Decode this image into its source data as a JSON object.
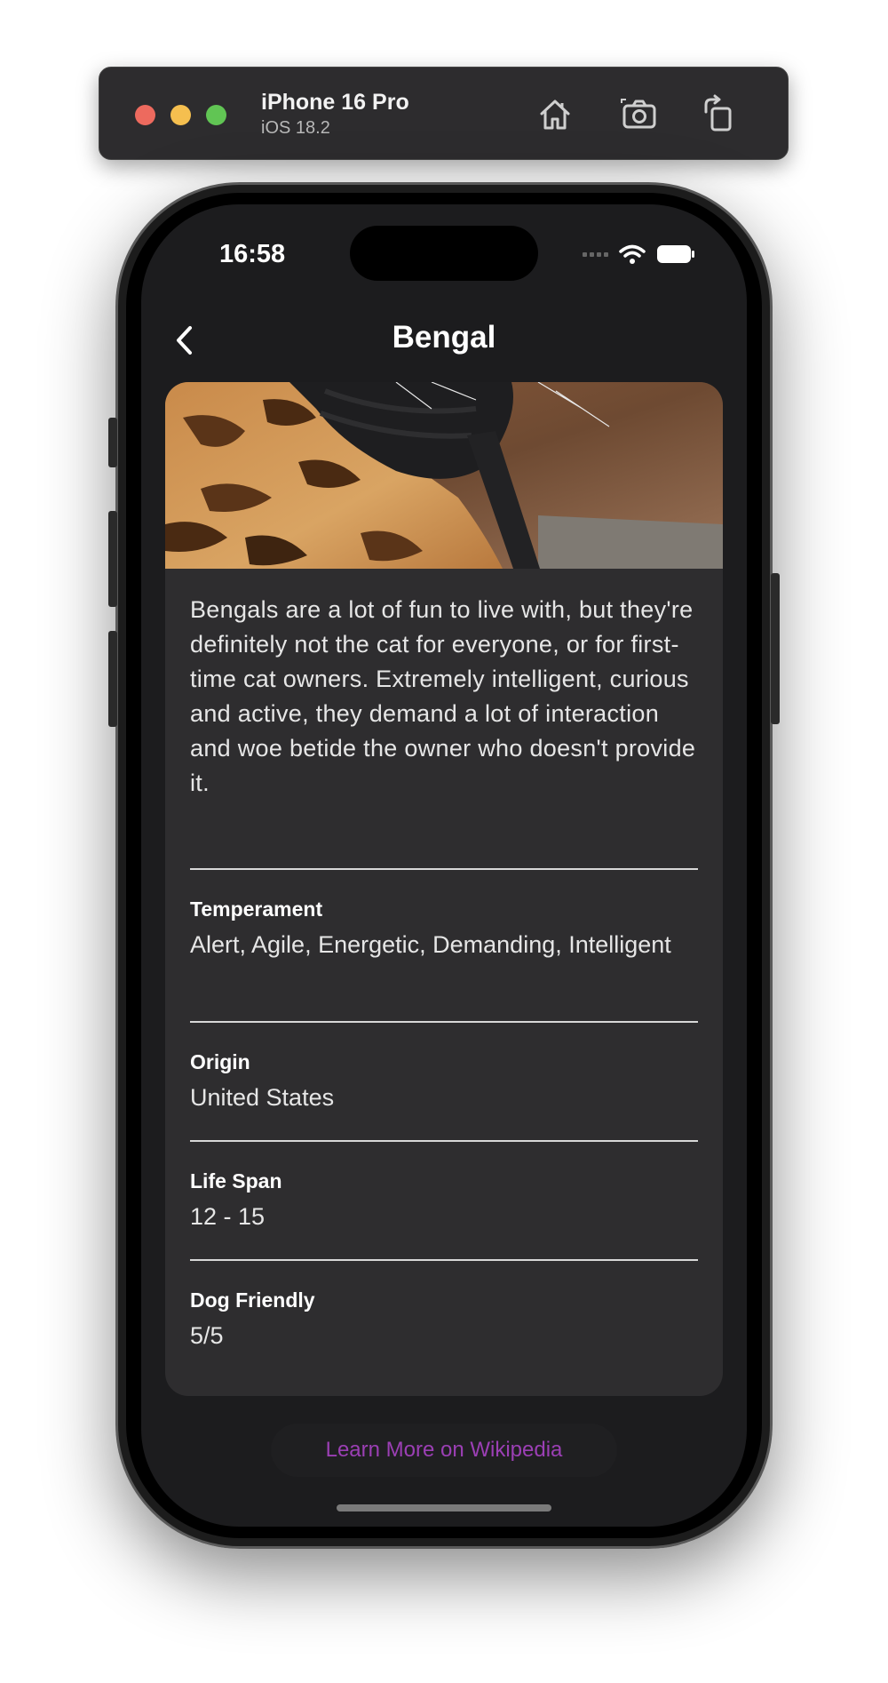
{
  "simulator": {
    "device_name": "iPhone 16 Pro",
    "os_version": "iOS 18.2",
    "toolbar_icons": [
      "home-icon",
      "screenshot-icon",
      "rotate-icon"
    ]
  },
  "status_bar": {
    "time": "16:58",
    "icons": [
      "cellular-icon",
      "wifi-icon",
      "battery-icon"
    ]
  },
  "nav": {
    "title": "Bengal",
    "back_icon": "chevron-left-icon"
  },
  "breed": {
    "description": "Bengals are a lot of fun to live with, but they're definitely not the cat for everyone, or for first-time cat owners. Extremely intelligent, curious and active, they demand a lot of interaction and woe betide the owner who doesn't provide it.",
    "details": [
      {
        "label": "Temperament",
        "value": "Alert, Agile, Energetic, Demanding, Intelligent"
      },
      {
        "label": "Origin",
        "value": "United States"
      },
      {
        "label": "Life Span",
        "value": "12 - 15"
      },
      {
        "label": "Dog Friendly",
        "value": "5/5"
      }
    ]
  },
  "footer": {
    "wiki_button_label": "Learn More on Wikipedia"
  },
  "colors": {
    "screen_bg": "#1c1c1e",
    "card_bg": "#2e2d2f",
    "accent": "#9b3fb4"
  }
}
